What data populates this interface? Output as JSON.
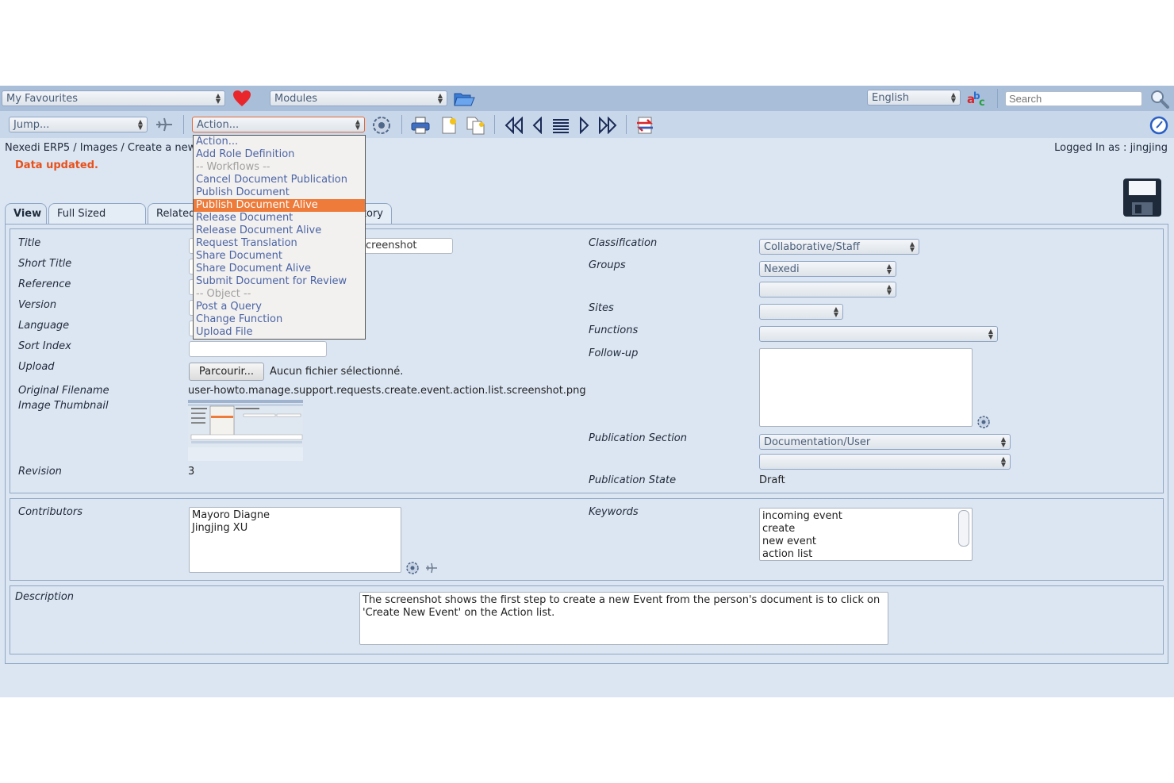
{
  "topbar": {
    "favourites": "My Favourites",
    "modules": "Modules",
    "language": "English",
    "search_placeholder": "Search"
  },
  "toolbar": {
    "jump": "Jump...",
    "action": "Action..."
  },
  "breadcrumb": "Nexedi ERP5 / Images / Create a new",
  "logged_in": "Logged In as : jingjing",
  "status_message": "Data updated.",
  "tabs": [
    "View",
    "Full Sized Image",
    "Related",
    "History"
  ],
  "tab_history_visible": "tory",
  "action_menu": [
    {
      "label": "Action...",
      "kind": "item"
    },
    {
      "label": "Add Role Definition",
      "kind": "item"
    },
    {
      "label": "-- Workflows --",
      "kind": "group"
    },
    {
      "label": "Cancel Document Publication",
      "kind": "item"
    },
    {
      "label": "Publish Document",
      "kind": "item"
    },
    {
      "label": "Publish Document Alive",
      "kind": "highlight"
    },
    {
      "label": "Release Document",
      "kind": "item"
    },
    {
      "label": "Release Document Alive",
      "kind": "item"
    },
    {
      "label": "Request Translation",
      "kind": "item"
    },
    {
      "label": "Share Document",
      "kind": "item"
    },
    {
      "label": "Share Document Alive",
      "kind": "item"
    },
    {
      "label": "Submit Document for Review",
      "kind": "item"
    },
    {
      "label": "-- Object --",
      "kind": "group"
    },
    {
      "label": "Post a Query",
      "kind": "item"
    },
    {
      "label": "Change Function",
      "kind": "item"
    },
    {
      "label": "Upload File",
      "kind": "item"
    }
  ],
  "form": {
    "title_label": "Title",
    "title_value_visible": "creenshot",
    "short_title_label": "Short Title",
    "reference_label": "Reference",
    "version_label": "Version",
    "language_label": "Language",
    "sort_index_label": "Sort Index",
    "upload_label": "Upload",
    "browse_button": "Parcourir...",
    "no_file": "Aucun fichier sélectionné.",
    "original_filename_label": "Original Filename",
    "original_filename": "user-howto.manage.support.requests.create.event.action.list.screenshot.png",
    "image_thumbnail_label": "Image Thumbnail",
    "revision_label": "Revision",
    "revision": "3",
    "classification_label": "Classification",
    "classification": "Collaborative/Staff",
    "groups_label": "Groups",
    "groups": "Nexedi",
    "sites_label": "Sites",
    "functions_label": "Functions",
    "followup_label": "Follow-up",
    "publication_section_label": "Publication Section",
    "publication_section": "Documentation/User",
    "publication_state_label": "Publication State",
    "publication_state": "Draft",
    "contributors_label": "Contributors",
    "contributors": [
      "Mayoro Diagne",
      "Jingjing XU"
    ],
    "keywords_label": "Keywords",
    "keywords": [
      "incoming event",
      "create",
      "new event",
      "action list"
    ],
    "description_label": "Description",
    "description": "The screenshot  shows the first step to create a new Event from the person's document is to click on 'Create New Event' on the Action list."
  },
  "colors": {
    "accent_orange": "#ee7b3a",
    "status_red": "#e8501a",
    "menu_link": "#4a64a6"
  }
}
